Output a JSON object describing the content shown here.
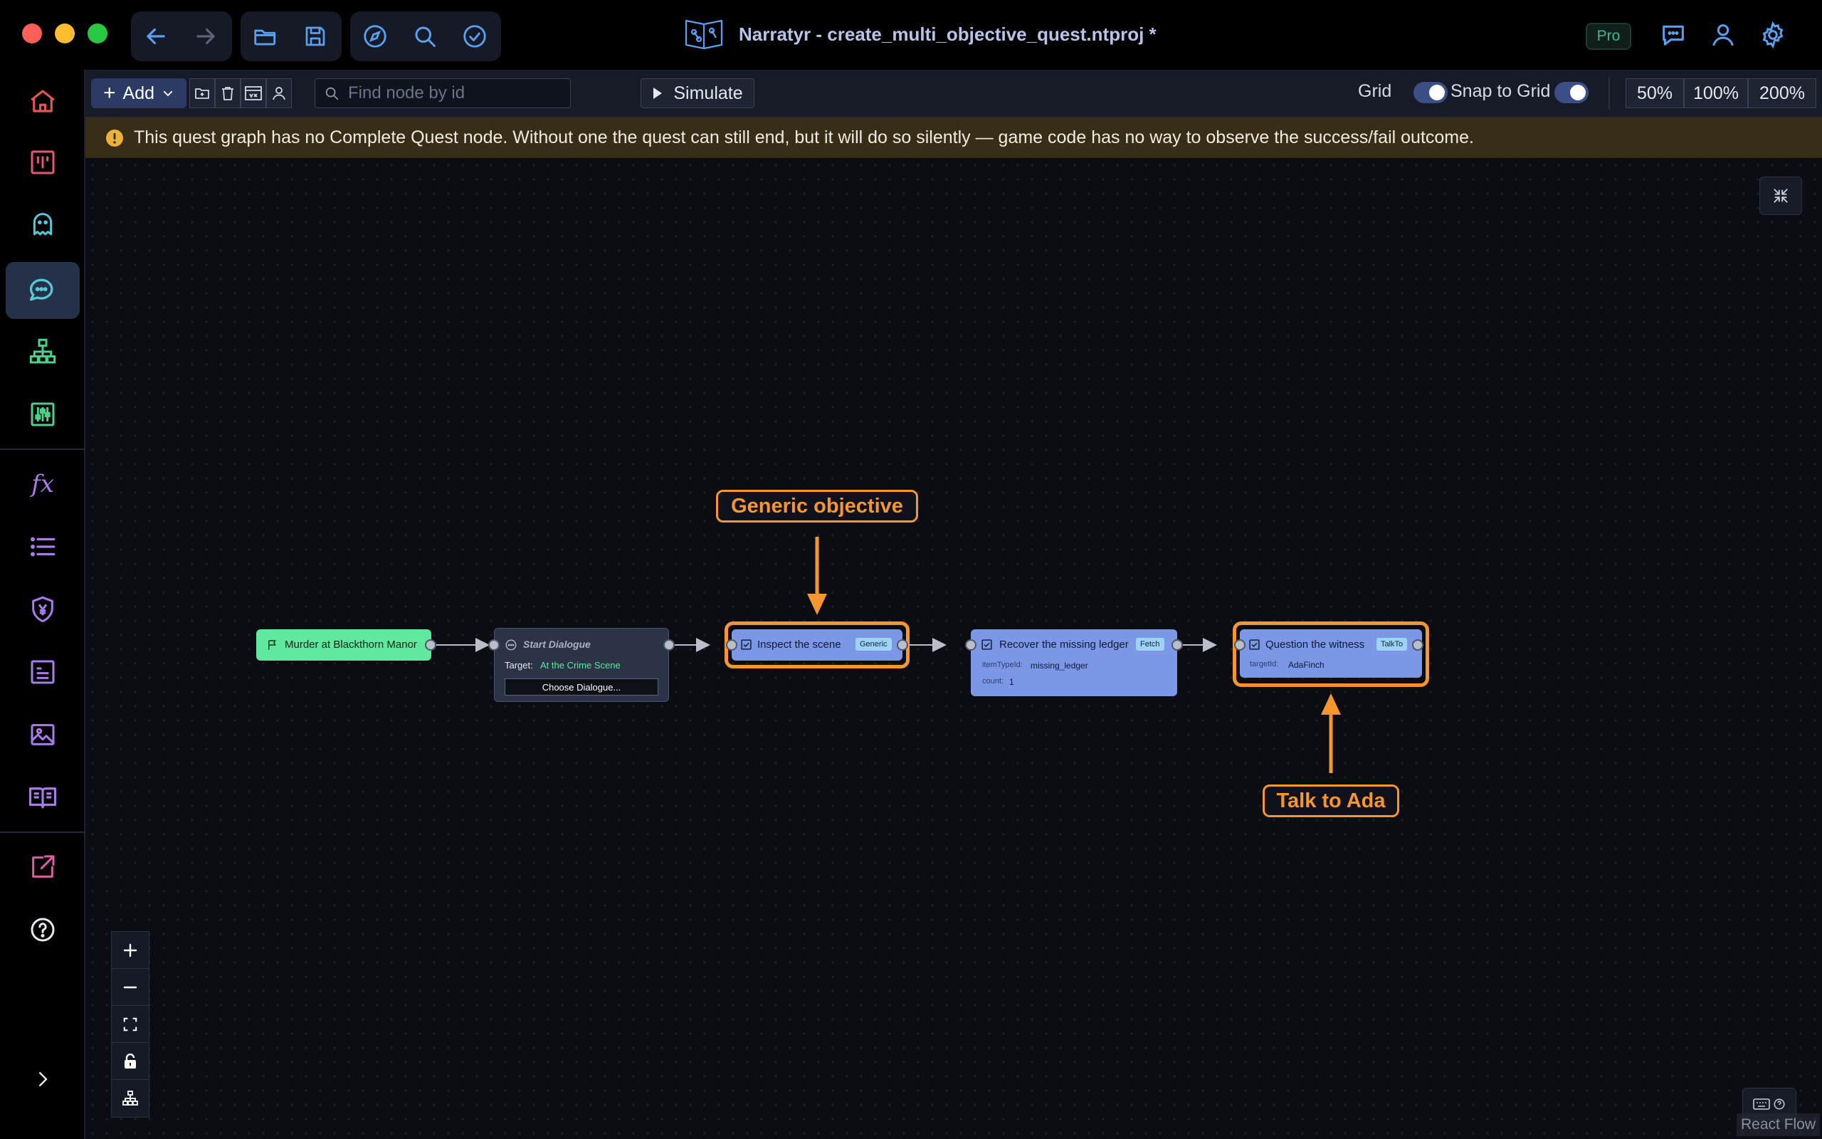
{
  "window": {
    "title": "Narratyr - create_multi_objective_quest.ntproj *",
    "badge": "Pro"
  },
  "colors": {
    "accent_orange": "#f7962c",
    "node_blue": "#7b97e6",
    "node_green": "#5fe89e",
    "node_dark": "#2b3346",
    "warning_bg": "#382e17"
  },
  "titlebar": {
    "left_icons": [
      "back-arrow-icon",
      "forward-arrow-icon",
      "folder-open-icon",
      "save-icon",
      "compass-icon",
      "search-icon",
      "check-circle-icon"
    ],
    "right_icons": [
      "chat-icon",
      "user-icon",
      "settings-gear-icon"
    ]
  },
  "sidebar": {
    "items": [
      "home-icon",
      "board-icon",
      "ghost-icon",
      "dialogue-icon",
      "hierarchy-icon",
      "sliders-icon",
      "function-icon",
      "list-icon",
      "currency-shield-icon",
      "terminal-icon",
      "image-icon",
      "book-icon",
      "export-icon",
      "help-icon",
      "expand-chevron-icon"
    ],
    "function_label": "fx"
  },
  "toolbar": {
    "add_label": "Add",
    "search_placeholder": "Find node by id",
    "simulate_label": "Simulate",
    "grid_label": "Grid",
    "grid_on": true,
    "snap_label": "Snap to Grid",
    "snap_on": true,
    "zoom_options": [
      "50%",
      "100%",
      "200%"
    ]
  },
  "warning": {
    "text": "This quest graph has no Complete Quest node. Without one the quest can still end, but it will do so silently — game code has no way to observe the success/fail outcome."
  },
  "graph": {
    "start": {
      "title": "Murder at Blackthorn Manor"
    },
    "dialogue": {
      "title": "Start Dialogue",
      "target_label": "Target:",
      "target_value": "At the Crime Scene",
      "button": "Choose Dialogue..."
    },
    "objectives": [
      {
        "title": "Inspect the scene",
        "badge": "Generic"
      },
      {
        "title": "Recover the missing ledger",
        "badge": "Fetch",
        "fields": [
          {
            "label": "itemTypeId:",
            "value": "missing_ledger"
          },
          {
            "label": "count:",
            "value": "1"
          }
        ]
      },
      {
        "title": "Question the witness",
        "badge": "TalkTo",
        "fields": [
          {
            "label": "targetId:",
            "value": "AdaFinch"
          }
        ]
      }
    ]
  },
  "callouts": {
    "top": "Generic objective",
    "bottom": "Talk to Ada"
  },
  "footer": {
    "attribution": "React Flow"
  }
}
